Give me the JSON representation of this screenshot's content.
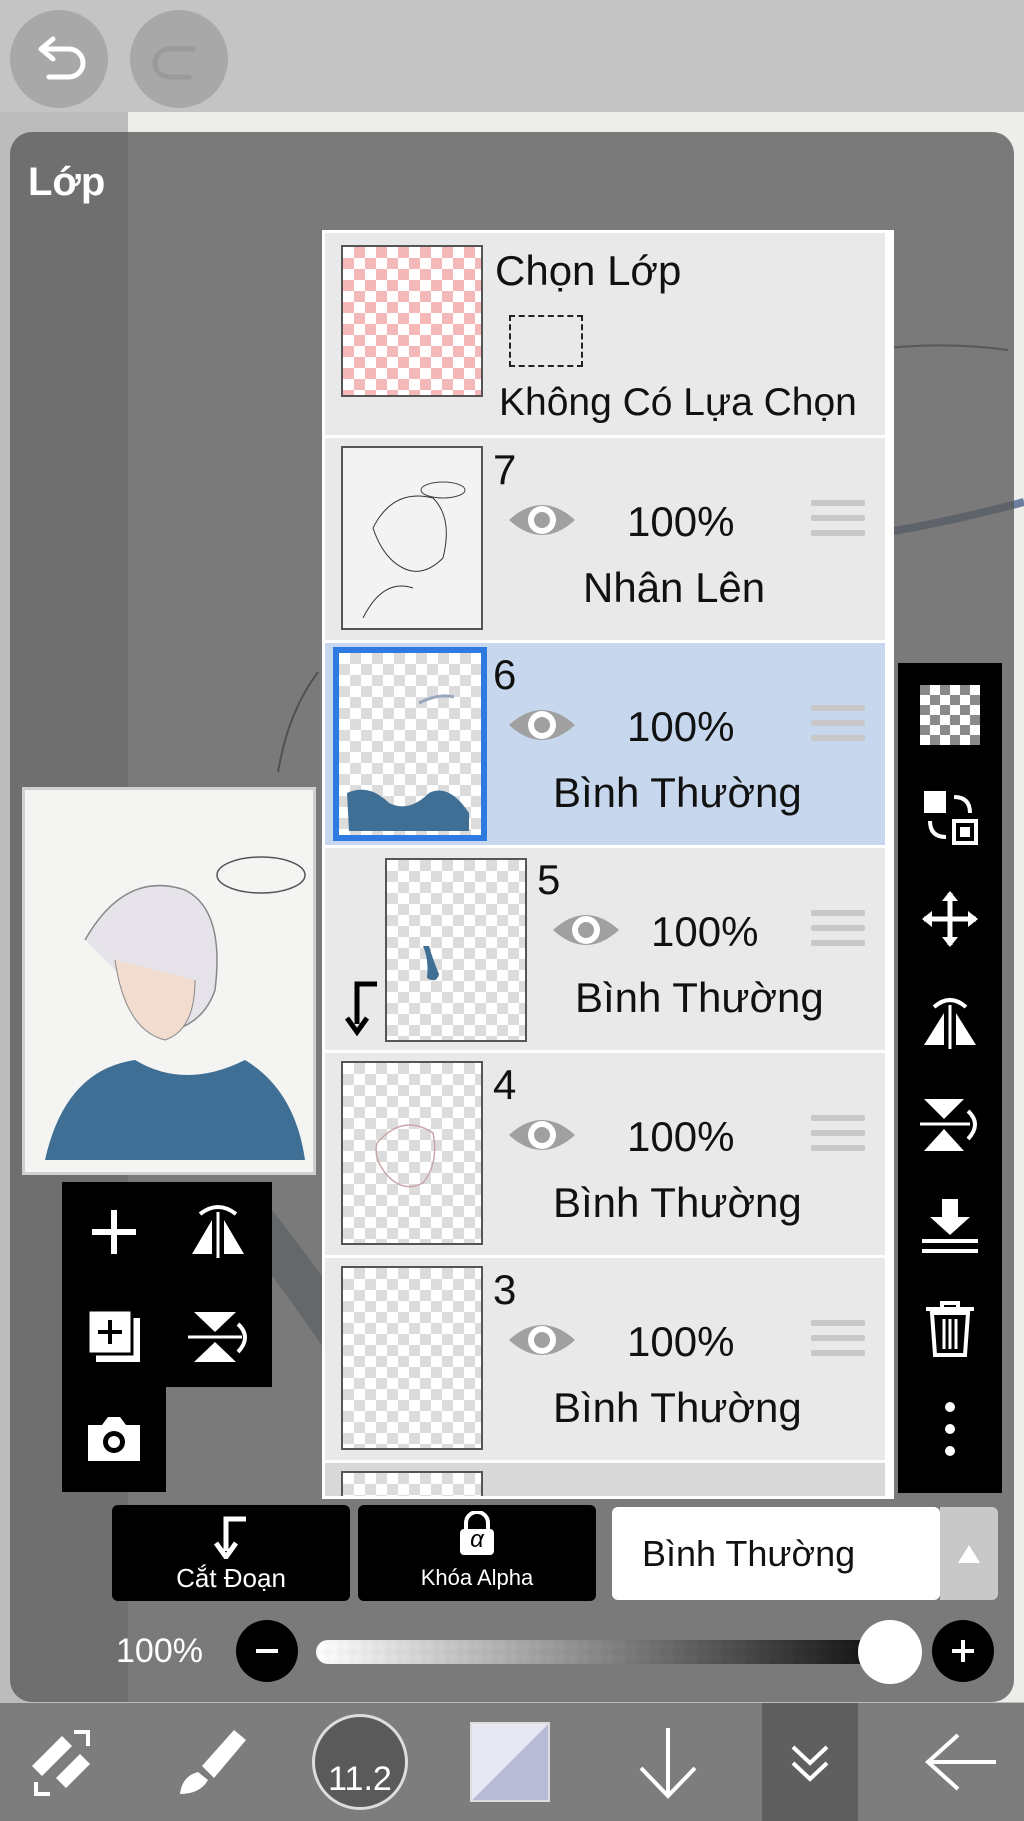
{
  "panel": {
    "title": "Lớp"
  },
  "selection_layer": {
    "title": "Chọn Lớp",
    "status": "Không Có Lựa Chọn"
  },
  "layers": [
    {
      "number": "7",
      "opacity": "100%",
      "blend": "Nhân Lên"
    },
    {
      "number": "6",
      "opacity": "100%",
      "blend": "Bình Thường",
      "selected": true
    },
    {
      "number": "5",
      "opacity": "100%",
      "blend": "Bình Thường",
      "clipped": true
    },
    {
      "number": "4",
      "opacity": "100%",
      "blend": "Bình Thường"
    },
    {
      "number": "3",
      "opacity": "100%",
      "blend": "Bình Thường"
    }
  ],
  "controls": {
    "clip_label": "Cắt Đoạn",
    "alpha_lock_label": "Khóa Alpha",
    "alpha_symbol": "α",
    "blend_mode": "Bình Thường",
    "opacity_label": "100%",
    "opacity_value": 1.0
  },
  "bottombar": {
    "brush_size": "11.2"
  },
  "colors": {
    "selected_row": "#c7d8ee",
    "selection_border": "#2f7ae0",
    "paint_blue": "#3f6f95"
  }
}
